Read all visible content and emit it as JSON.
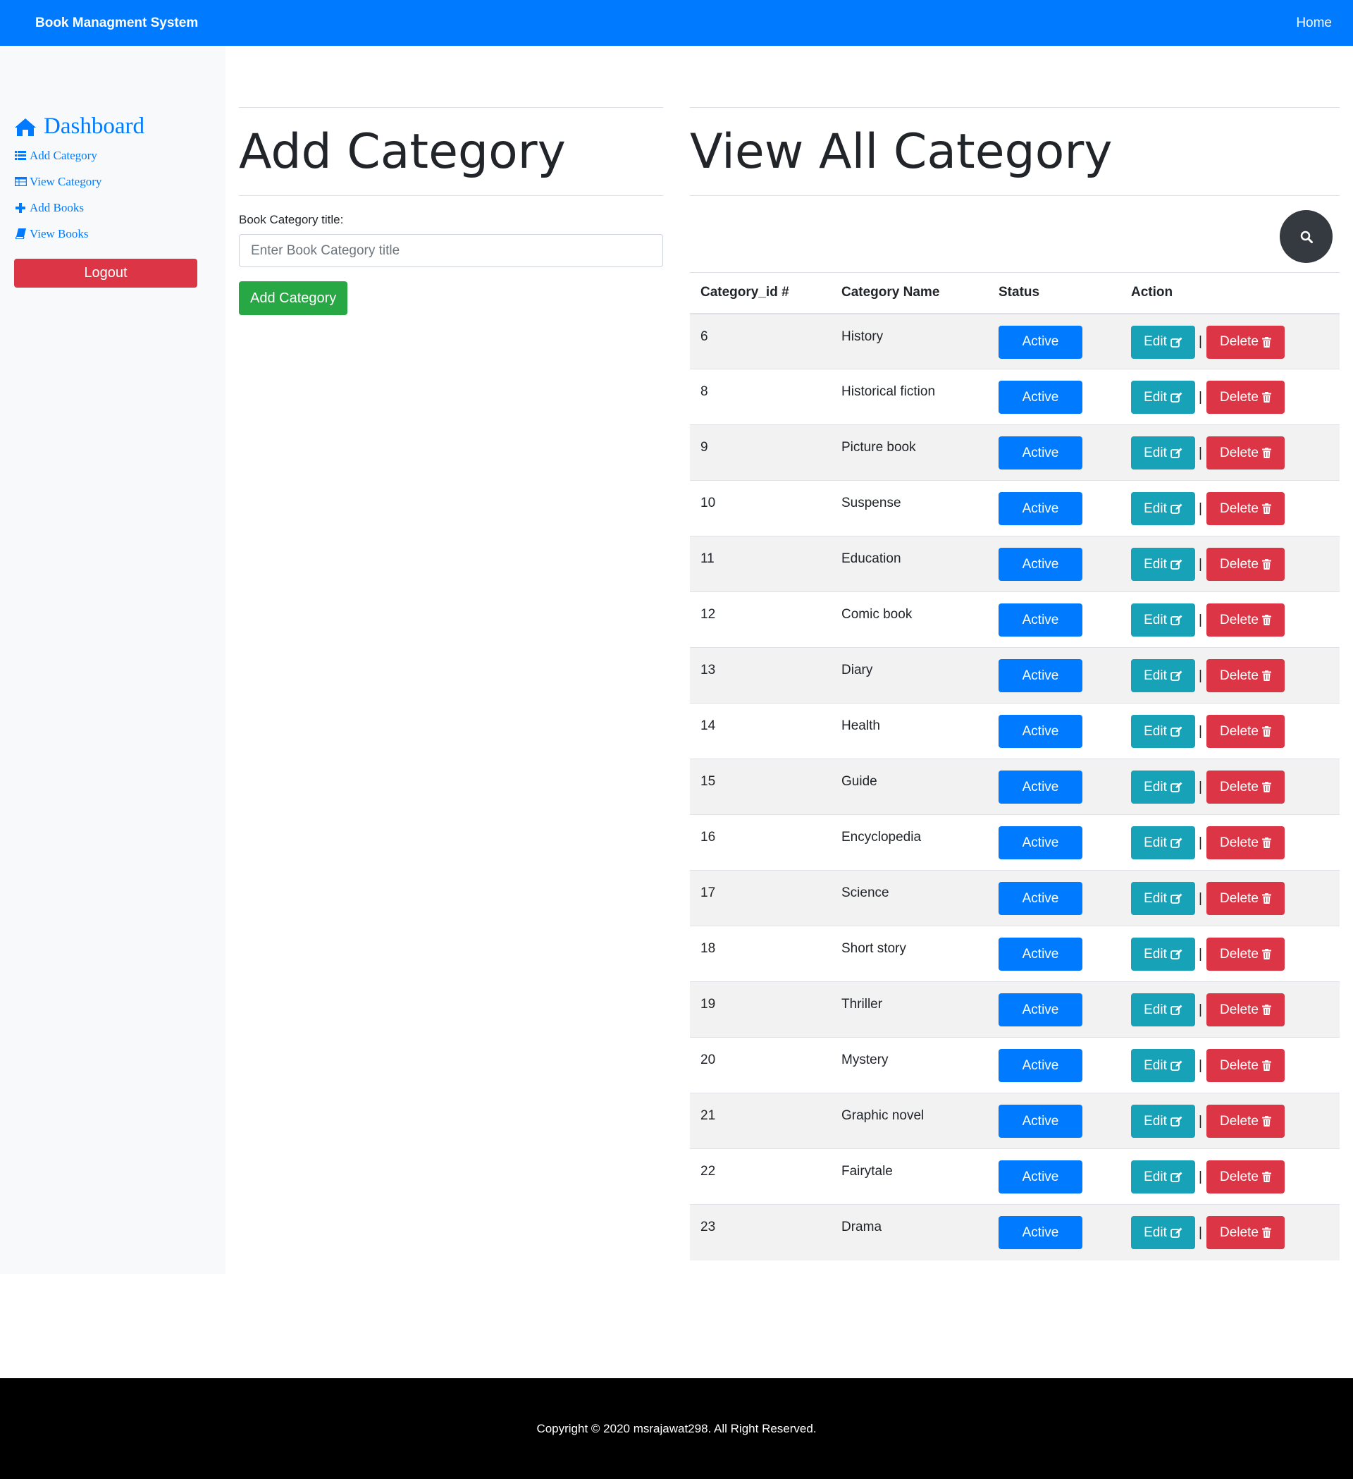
{
  "navbar": {
    "brand": "Book Managment System",
    "home_link": "Home"
  },
  "sidebar": {
    "title": "Dashboard",
    "title_icon": "home-icon",
    "items": [
      {
        "label": "Add Category",
        "icon": "list-icon"
      },
      {
        "label": "View Category",
        "icon": "table-icon"
      },
      {
        "label": "Add Books",
        "icon": "plus-icon"
      },
      {
        "label": "View Books",
        "icon": "book-icon"
      }
    ],
    "logout_label": "Logout"
  },
  "add_panel": {
    "title": "Add Category",
    "field_label": "Book Category title:",
    "field_placeholder": "Enter Book Category title",
    "field_value": "",
    "submit_label": "Add Category"
  },
  "view_panel": {
    "title": "View All Category",
    "search_icon": "search-icon",
    "columns": [
      "Category_id #",
      "Category Name",
      "Status",
      "Action"
    ],
    "edit_label": "Edit",
    "delete_label": "Delete",
    "separator": "|",
    "rows": [
      {
        "id": "6",
        "name": "History",
        "status": "Active"
      },
      {
        "id": "8",
        "name": "Historical fiction",
        "status": "Active"
      },
      {
        "id": "9",
        "name": "Picture book",
        "status": "Active"
      },
      {
        "id": "10",
        "name": "Suspense",
        "status": "Active"
      },
      {
        "id": "11",
        "name": "Education",
        "status": "Active"
      },
      {
        "id": "12",
        "name": "Comic book",
        "status": "Active"
      },
      {
        "id": "13",
        "name": "Diary",
        "status": "Active"
      },
      {
        "id": "14",
        "name": "Health",
        "status": "Active"
      },
      {
        "id": "15",
        "name": "Guide",
        "status": "Active"
      },
      {
        "id": "16",
        "name": "Encyclopedia",
        "status": "Active"
      },
      {
        "id": "17",
        "name": "Science",
        "status": "Active"
      },
      {
        "id": "18",
        "name": "Short story",
        "status": "Active"
      },
      {
        "id": "19",
        "name": "Thriller",
        "status": "Active"
      },
      {
        "id": "20",
        "name": "Mystery",
        "status": "Active"
      },
      {
        "id": "21",
        "name": "Graphic novel",
        "status": "Active"
      },
      {
        "id": "22",
        "name": "Fairytale",
        "status": "Active"
      },
      {
        "id": "23",
        "name": "Drama",
        "status": "Active"
      }
    ]
  },
  "footer": {
    "copyright": "Copyright © 2020 msrajawat298. All Right Reserved."
  },
  "colors": {
    "primary": "#007bff",
    "success": "#28a745",
    "danger": "#dc3545",
    "info": "#17a2b8",
    "dark": "#343a40"
  }
}
